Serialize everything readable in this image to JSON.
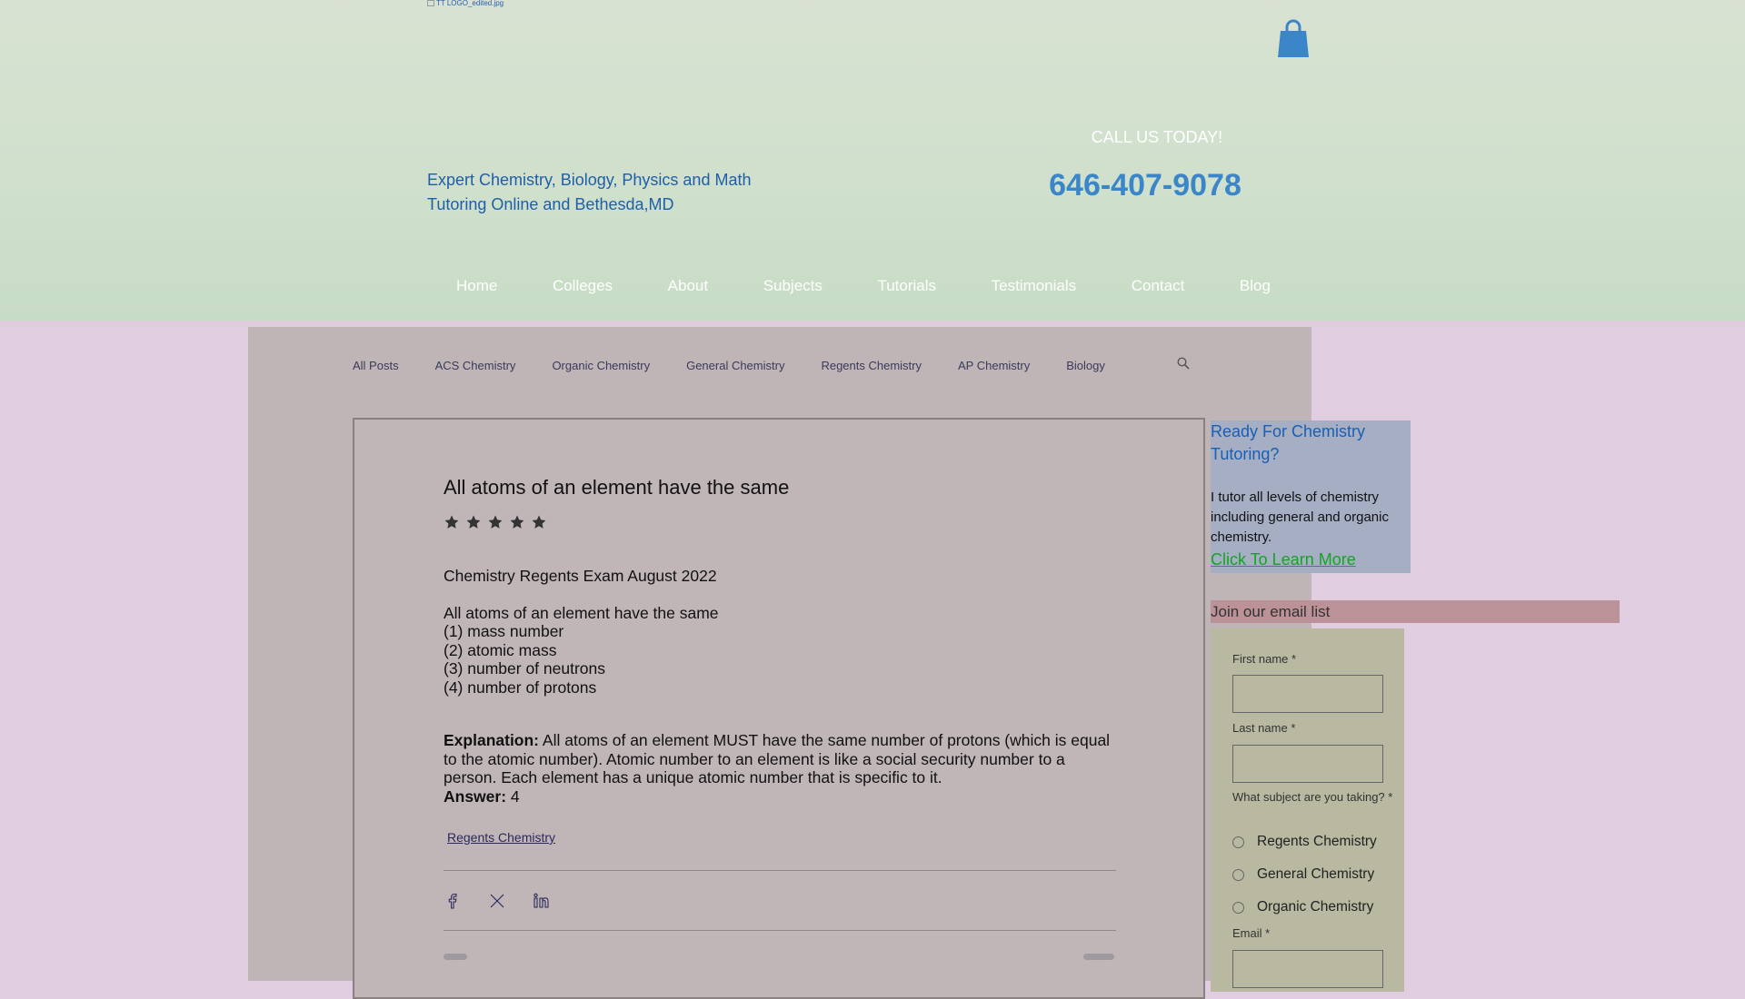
{
  "header": {
    "logo_alt": "TT LOGO_edited.jpg",
    "tagline": " Expert Chemistry, Biology, Physics and Math\nTutoring Online and Bethesda,MD",
    "call_label": "CALL US TODAY!",
    "phone": "646-407-9078",
    "cart_icon": "shopping-bag-icon"
  },
  "nav": {
    "items": [
      "Home",
      "Colleges",
      "About",
      "Subjects",
      "Tutorials",
      "Testimonials",
      "Contact",
      "Blog"
    ]
  },
  "categories": {
    "items": [
      "All Posts",
      "ACS Chemistry",
      "Organic Chemistry",
      "General Chemistry",
      "Regents Chemistry",
      "AP Chemistry",
      "Biology"
    ]
  },
  "post": {
    "title": "All atoms of an element have the same",
    "rating_stars": 5,
    "heading": "Chemistry Regents Exam August 2022",
    "question": "All atoms of an element have the same",
    "options": [
      "(1) mass number",
      "(2) atomic mass",
      "(3) number of neutrons",
      "(4) number of protons"
    ],
    "explanation_label": "Explanation:",
    "explanation": " All atoms of an element MUST have the same number of protons (which is equal to the atomic number). Atomic number to an element is like a social security number to a person. Each element has a unique atomic number that is specific to it.",
    "answer_label": "Answer:",
    "answer": " 4",
    "tag": "Regents Chemistry",
    "share_icons": [
      "facebook-icon",
      "x-icon",
      "linkedin-icon"
    ]
  },
  "promo": {
    "title": "Ready For Chemistry Tutoring?",
    "text": "I tutor all levels of chemistry including general and organic chemistry.",
    "link": "Click To Learn More"
  },
  "signup": {
    "heading": "Join our email list",
    "first_name_label": "First name *",
    "last_name_label": "Last name *",
    "subject_label": "What subject are you taking? *",
    "subject_options": [
      "Regents Chemistry",
      "General Chemistry",
      "Organic Chemistry"
    ],
    "email_label": "Email *"
  },
  "colors": {
    "header_bg": "#d2e0cd",
    "page_bg": "#e0cde0",
    "accent_blue": "#3a86c8",
    "link_green": "#1aa02a"
  }
}
